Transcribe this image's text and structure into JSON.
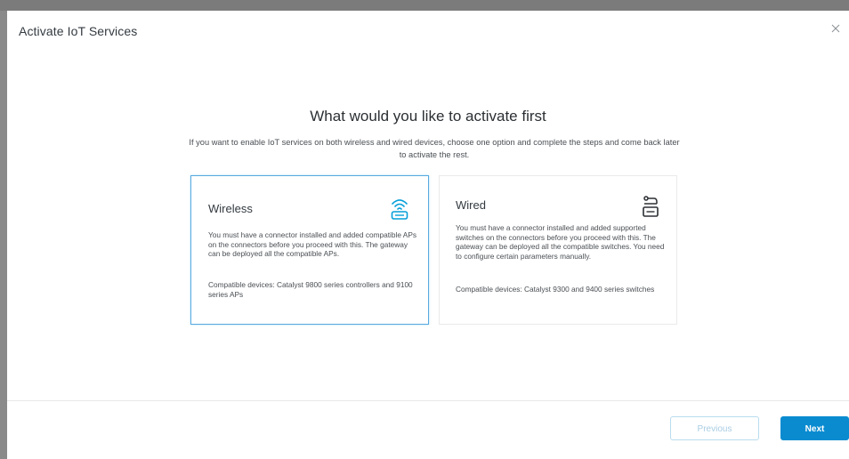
{
  "modal": {
    "title": "Activate IoT Services",
    "close_icon": "close-icon"
  },
  "content": {
    "heading": "What would you like to activate first",
    "subheading": "If you want to enable IoT services on both wireless and wired devices, choose one option and complete the steps and come back later to activate the rest."
  },
  "options": [
    {
      "id": "wireless",
      "title": "Wireless",
      "icon": "wireless-router-icon",
      "description": "You must have a connector installed and added compatible APs on the connectors before you proceed with this. The gateway can be deployed all the compatible APs.",
      "compatible": "Compatible devices: Catalyst 9800 series controllers and 9100 series APs",
      "selected": true
    },
    {
      "id": "wired",
      "title": "Wired",
      "icon": "wired-switch-icon",
      "description": "You must have a connector installed and added supported switches on the connectors before you proceed with this. The gateway can be deployed all the compatible switches. You need to configure certain parameters manually.",
      "compatible": "Compatible devices: Catalyst 9300 and 9400 series switches",
      "selected": false
    }
  ],
  "footer": {
    "previous_label": "Previous",
    "next_label": "Next"
  },
  "colors": {
    "accent": "#0a8bd0",
    "icon_blue": "#049fd9",
    "selected_border": "#5aa9e0"
  }
}
